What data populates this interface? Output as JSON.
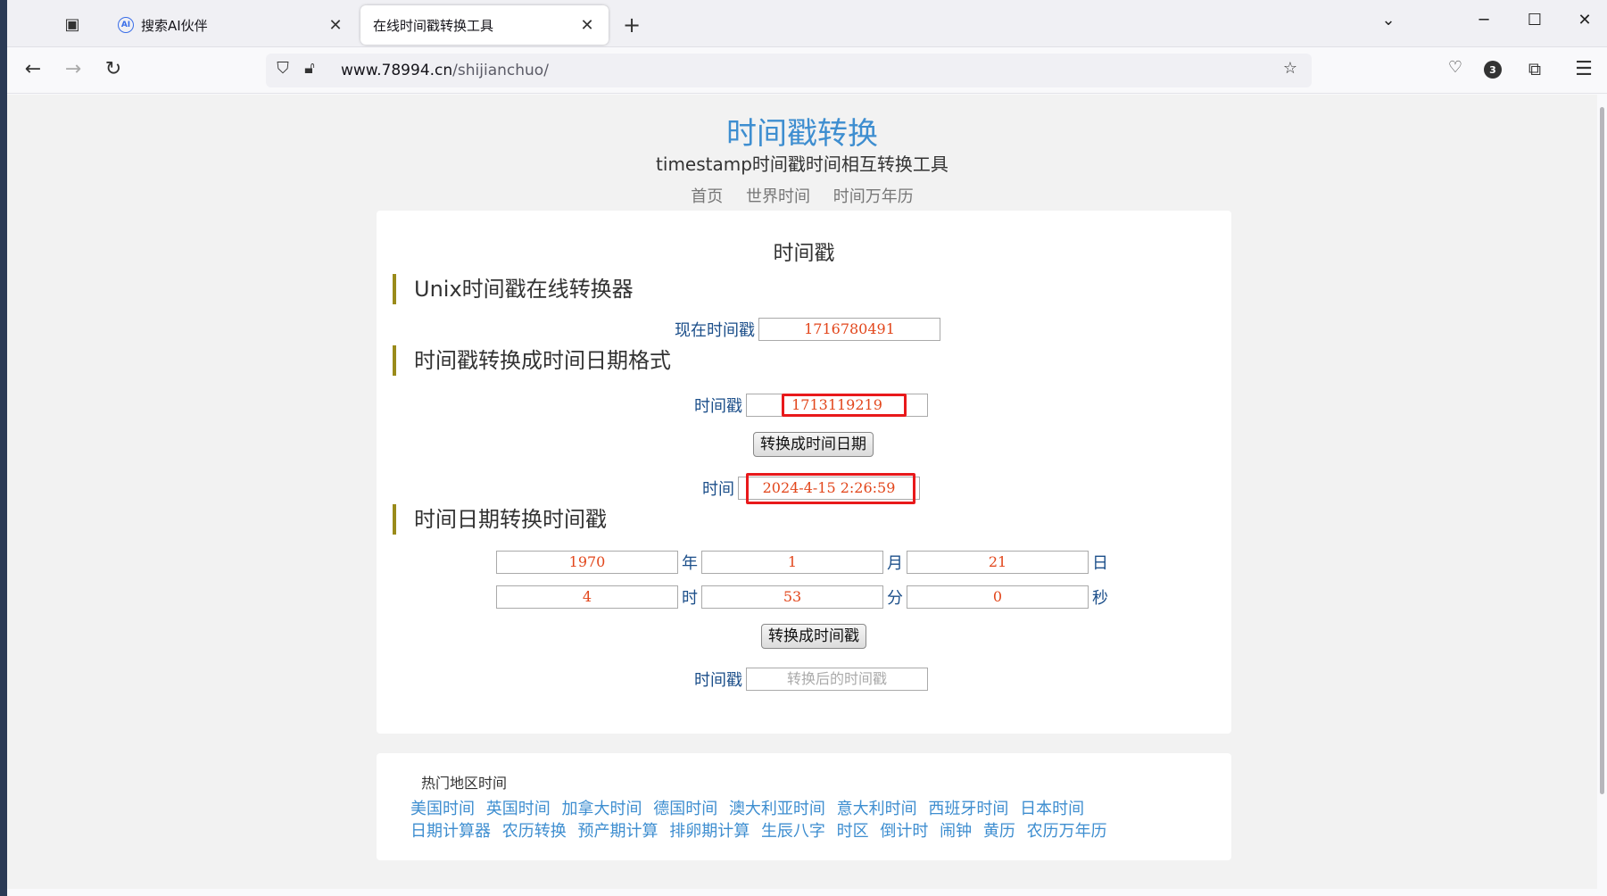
{
  "browser": {
    "tabs": [
      {
        "label": "搜索AI伙伴",
        "icon": "ai-favicon-icon"
      },
      {
        "label": "在线时间戳转换工具",
        "icon": null
      }
    ],
    "url_host": "www.78994.cn",
    "url_path": "/shijianchuo/",
    "extension_badge": "3"
  },
  "page": {
    "site_title": "时间戳转换",
    "site_subtitle": "timestamp时间戳时间相互转换工具",
    "nav": [
      "首页",
      "世界时间",
      "时间万年历"
    ],
    "card_title": "时间戳",
    "section1": "Unix时间戳在线转换器",
    "current_label": "现在时间戳",
    "current_value": "1716780491",
    "section2": "时间戳转换成时间日期格式",
    "ts_label": "时间戳",
    "ts_value": "1713119219",
    "convert_to_date_btn": "转换成时间日期",
    "time_label": "时间",
    "time_value": "2024-4-15 2:26:59",
    "section3": "时间日期转换时间戳",
    "year": "1970",
    "year_unit": "年",
    "month": "1",
    "month_unit": "月",
    "day": "21",
    "day_unit": "日",
    "hour": "4",
    "hour_unit": "时",
    "minute": "53",
    "minute_unit": "分",
    "second": "0",
    "second_unit": "秒",
    "convert_to_ts_btn": "转换成时间戳",
    "result_label": "时间戳",
    "result_placeholder": "转换后的时间戳",
    "hot_title": "热门地区时间",
    "hot_links_1": [
      "美国时间",
      "英国时间",
      "加拿大时间",
      "德国时间",
      "澳大利亚时间",
      "意大利时间",
      "西班牙时间",
      "日本时间"
    ],
    "hot_links_2": [
      "日期计算器",
      "农历转换",
      "预产期计算",
      "排卵期计算",
      "生辰八字",
      "时区",
      "倒计时",
      "闹钟",
      "黄历",
      "农历万年历"
    ]
  }
}
